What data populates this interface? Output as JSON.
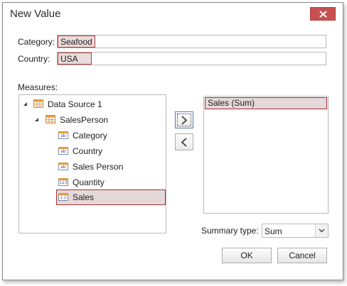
{
  "window": {
    "title": "New Value"
  },
  "filters": {
    "category_label": "Category:",
    "category_value": "Seafood",
    "country_label": "Country:",
    "country_value": "USA"
  },
  "measures": {
    "label": "Measures:",
    "tree": {
      "root": "Data Source 1",
      "table": "SalesPerson",
      "fields": [
        {
          "label": "Category",
          "icon": "ab",
          "type": "text-field-icon"
        },
        {
          "label": "Country",
          "icon": "ab",
          "type": "text-field-icon"
        },
        {
          "label": "Sales Person",
          "icon": "ab",
          "type": "text-field-icon"
        },
        {
          "label": "Quantity",
          "icon": "123",
          "type": "integer-field-icon"
        },
        {
          "label": "Sales",
          "icon": "1.2",
          "type": "decimal-field-icon",
          "selected": true
        }
      ]
    },
    "selected_items": [
      "Sales (Sum)"
    ]
  },
  "summary": {
    "label": "Summary type:",
    "value": "Sum"
  },
  "buttons": {
    "ok": "OK",
    "cancel": "Cancel"
  },
  "colors": {
    "close_button": "#c75050",
    "selection_border": "#a62f33",
    "selection_fill": "#e4d8da"
  }
}
